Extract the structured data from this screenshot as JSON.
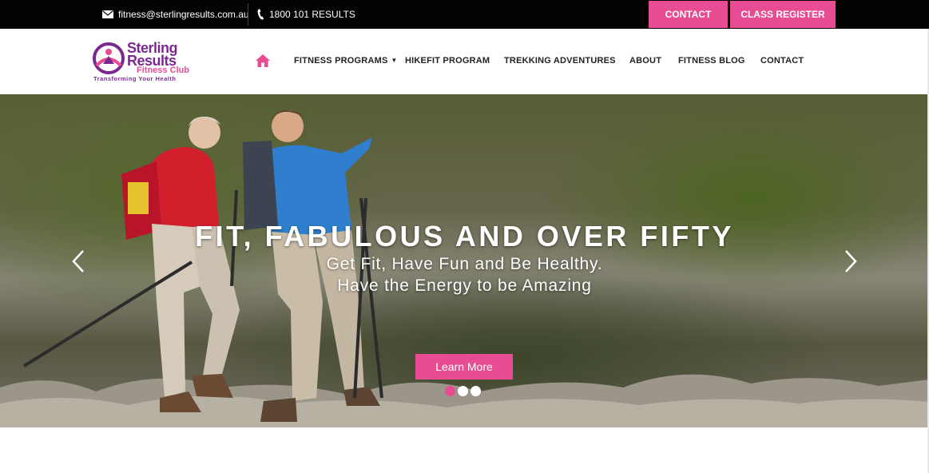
{
  "topbar": {
    "email": "fitness@sterlingresults.com.au",
    "email_icon": "envelope-icon",
    "phone": "1800 101 RESULTS",
    "phone_icon": "phone-icon",
    "contact_button": "CONTACT",
    "register_button": "CLASS REGISTER"
  },
  "logo": {
    "line1": "Sterling",
    "line2": "Results",
    "line3": "Fitness Club",
    "tagline": "Transforming Your Health"
  },
  "nav": {
    "home_icon": "home-icon",
    "items": [
      {
        "label": "FITNESS PROGRAMS",
        "has_dropdown": true
      },
      {
        "label": "HIKEFIT PROGRAM"
      },
      {
        "label": "TREKKING ADVENTURES"
      },
      {
        "label": "ABOUT"
      },
      {
        "label": "FITNESS BLOG"
      },
      {
        "label": "CONTACT"
      }
    ]
  },
  "hero": {
    "title": "FIT, FABULOUS AND OVER FIFTY",
    "subtitle_line1": "Get Fit, Have Fun and Be Healthy.",
    "subtitle_line2": "Have the Energy to be Amazing",
    "button": "Learn More",
    "slides_total": 3,
    "active_slide": 1
  },
  "colors": {
    "accent": "#e84c93",
    "brand_purple": "#7a2a8f",
    "topbar_bg": "#030303"
  }
}
